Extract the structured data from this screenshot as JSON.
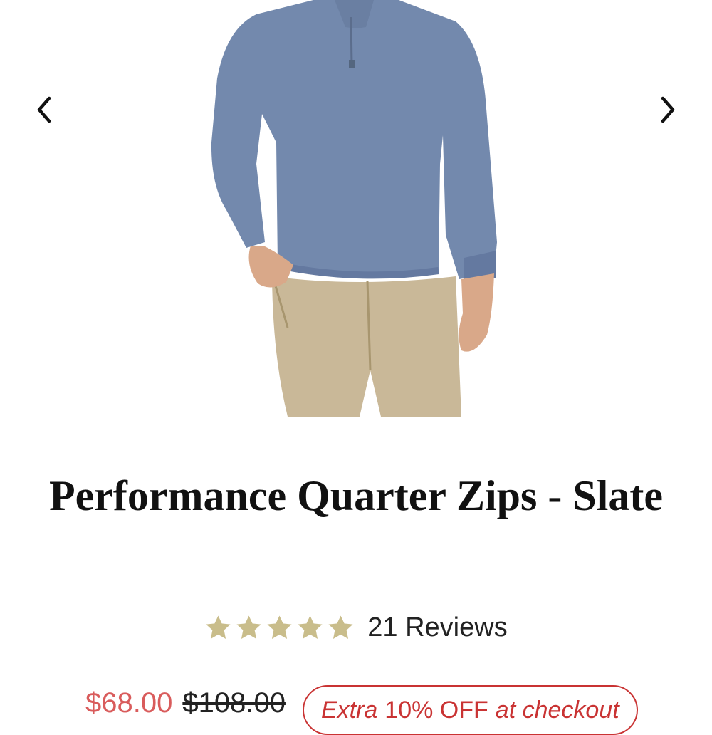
{
  "gallery": {
    "prev_icon": "chevron-left-icon",
    "next_icon": "chevron-right-icon",
    "colors": {
      "shirt": "#7389ad",
      "pants": "#c9b898",
      "skin": "#d9a889"
    }
  },
  "product": {
    "title": "Performance Quarter Zips - Slate"
  },
  "rating": {
    "stars": 5,
    "max_stars": 5,
    "star_color": "#c9bd8b",
    "reviews_label": "21 Reviews"
  },
  "price": {
    "sale": "$68.00",
    "original": "$108.00",
    "sale_color": "#d95c5c"
  },
  "promo": {
    "prefix": "Extra",
    "highlight": "10% OFF",
    "suffix": "at checkout",
    "color": "#c93333"
  }
}
